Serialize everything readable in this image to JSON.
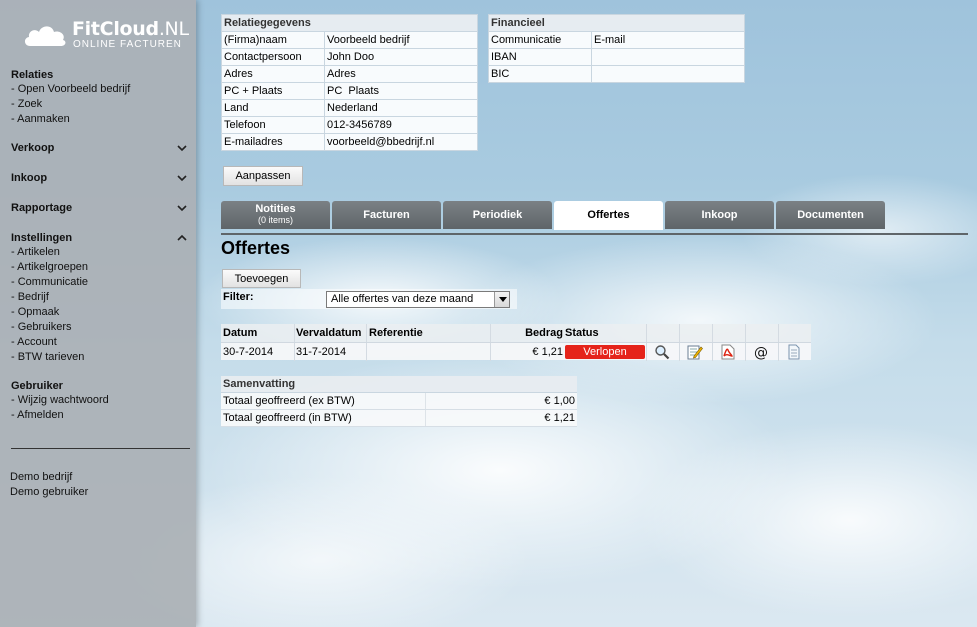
{
  "logo": {
    "title_bold": "FitCloud",
    "title_rest": ".NL",
    "subtitle": "ONLINE FACTUREN"
  },
  "sidebar": {
    "relaties": {
      "title": "Relaties",
      "links": [
        "- Open Voorbeeld bedrijf",
        "- Zoek",
        "- Aanmaken"
      ]
    },
    "verkoop": {
      "title": "Verkoop"
    },
    "inkoop": {
      "title": "Inkoop"
    },
    "rapportage": {
      "title": "Rapportage"
    },
    "instellingen": {
      "title": "Instellingen",
      "links": [
        "- Artikelen",
        "- Artikelgroepen",
        "- Communicatie",
        "- Bedrijf",
        "- Opmaak",
        "- Gebruikers",
        "- Account",
        "- BTW tarieven"
      ]
    },
    "gebruiker": {
      "title": "Gebruiker",
      "links": [
        "- Wijzig wachtwoord",
        "- Afmelden"
      ]
    },
    "demo": [
      "Demo bedrijf",
      "Demo gebruiker"
    ]
  },
  "relatie": {
    "title": "Relatiegegevens",
    "rows": [
      [
        "(Firma)naam",
        "Voorbeeld bedrijf"
      ],
      [
        "Contactpersoon",
        "John Doo"
      ],
      [
        "Adres",
        "Adres"
      ],
      [
        "PC + Plaats",
        "PC  Plaats"
      ],
      [
        "Land",
        "Nederland"
      ],
      [
        "Telefoon",
        "012-3456789"
      ],
      [
        "E-mailadres",
        "voorbeeld@bbedrijf.nl"
      ]
    ]
  },
  "financieel": {
    "title": "Financieel",
    "rows": [
      [
        "Communicatie",
        "E-mail"
      ],
      [
        "IBAN",
        ""
      ],
      [
        "BIC",
        ""
      ]
    ]
  },
  "buttons": {
    "aanpassen": "Aanpassen",
    "toevoegen": "Toevoegen"
  },
  "tabs": [
    {
      "label": "Notities",
      "sub": "(0 items)"
    },
    {
      "label": "Facturen"
    },
    {
      "label": "Periodiek"
    },
    {
      "label": "Offertes"
    },
    {
      "label": "Inkoop"
    },
    {
      "label": "Documenten"
    }
  ],
  "active_tab": "Offertes",
  "page_title": "Offertes",
  "filter": {
    "label": "Filter:",
    "selected": "Alle offertes van deze maand"
  },
  "offertes": {
    "headers": {
      "datum": "Datum",
      "vervaldatum": "Vervaldatum",
      "referentie": "Referentie",
      "bedrag": "Bedrag",
      "status": "Status"
    },
    "rows": [
      {
        "datum": "30-7-2014",
        "vervaldatum": "31-7-2014",
        "referentie": "",
        "bedrag": "€ 1,21",
        "status": "Verlopen"
      }
    ],
    "actions": [
      "view-icon",
      "edit-icon",
      "pdf-icon",
      "email-icon",
      "document-icon"
    ]
  },
  "samenvatting": {
    "title": "Samenvatting",
    "rows": [
      {
        "label": "Totaal geoffreerd (ex BTW)",
        "value": "€ 1,00"
      },
      {
        "label": "Totaal geoffreerd (in BTW)",
        "value": "€ 1,21"
      }
    ]
  },
  "colors": {
    "status_red": "#e5231a",
    "tab_dark": "#6b7175",
    "sidebar": "#aab0b5"
  }
}
